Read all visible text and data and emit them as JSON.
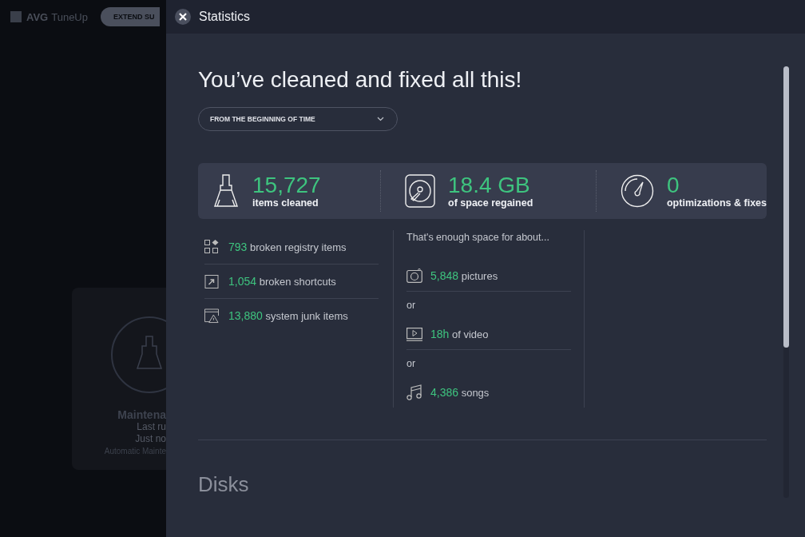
{
  "background_app": {
    "logo": "AVG",
    "product": "TuneUp",
    "button": "EXTEND SU",
    "card": {
      "title": "Maintena",
      "lines": [
        "Last ru",
        "Just no"
      ],
      "footer": "Automatic Mainte"
    }
  },
  "panel": {
    "title": "Statistics",
    "heading": "You’ve cleaned and fixed all this!",
    "period": "FROM THE BEGINNING OF TIME",
    "summary": [
      {
        "value": "15,727",
        "label": "items cleaned"
      },
      {
        "value": "18.4 GB",
        "label": "of space regained"
      },
      {
        "value": "0",
        "label": "optimizations & fixes"
      }
    ],
    "cleaned": [
      {
        "value": "793",
        "label": "broken registry items"
      },
      {
        "value": "1,054",
        "label": "broken shortcuts"
      },
      {
        "value": "13,880",
        "label": "system junk items"
      }
    ],
    "space": [
      {
        "kind": "text",
        "text": "That's enough space for about..."
      },
      {
        "kind": "stat",
        "value": "5,848",
        "label": "pictures"
      },
      {
        "kind": "text",
        "text": "or"
      },
      {
        "kind": "stat",
        "value": "18h",
        "label": "of video"
      },
      {
        "kind": "text",
        "text": "or"
      },
      {
        "kind": "stat",
        "value": "4,386",
        "label": "songs"
      }
    ],
    "section": "Disks"
  }
}
